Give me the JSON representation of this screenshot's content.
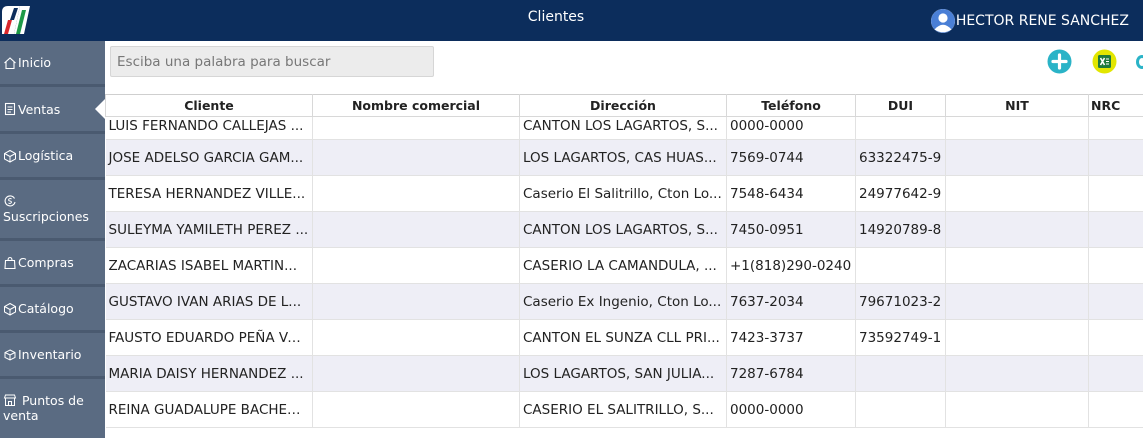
{
  "app": {
    "title": "Clientes",
    "user_name": "HECTOR RENE SANCHEZ"
  },
  "sidebar": {
    "items": [
      {
        "label": "Inicio",
        "icon": "home-icon"
      },
      {
        "label": "Ventas",
        "icon": "receipt-icon",
        "active": true
      },
      {
        "label": "Logística",
        "icon": "box-icon"
      },
      {
        "label": "Suscripciones",
        "icon": "dollar-cycle-icon"
      },
      {
        "label": "Compras",
        "icon": "shopping-bag-icon"
      },
      {
        "label": "Catálogo",
        "icon": "box-icon"
      },
      {
        "label": "Inventario",
        "icon": "boxes-icon"
      },
      {
        "label": "Puntos de venta",
        "icon": "store-icon"
      }
    ]
  },
  "search": {
    "placeholder": "Esciba una palabra para buscar",
    "value": ""
  },
  "toolbar": {
    "add_icon": "plus-circle-icon",
    "excel_icon": "excel-export-icon",
    "colors": {
      "add": "#2ab3c7",
      "excel_bg": "#e2e600",
      "excel_fg": "#1e7a3c"
    }
  },
  "table": {
    "headers": [
      "Cliente",
      "Nombre comercial",
      "Dirección",
      "Teléfono",
      "DUI",
      "NIT",
      "NRC"
    ],
    "rows": [
      [
        "LUIS FERNANDO CALLEJAS ...",
        "",
        "CANTON LOS LAGARTOS, S...",
        "0000-0000",
        "",
        "",
        ""
      ],
      [
        "JOSE ADELSO GARCIA GAM...",
        "",
        "LOS LAGARTOS, CAS HUAS...",
        "7569-0744",
        "63322475-9",
        "",
        ""
      ],
      [
        "TERESA HERNANDEZ VILLE...",
        "",
        "Caserio El Salitrillo, Cton Lo...",
        "7548-6434",
        "24977642-9",
        "",
        ""
      ],
      [
        "SULEYMA YAMILETH PEREZ ...",
        "",
        "CANTON LOS LAGARTOS, S...",
        "7450-0951",
        "14920789-8",
        "",
        ""
      ],
      [
        "ZACARIAS ISABEL MARTIN...",
        "",
        "CASERIO LA CAMANDULA, ...",
        "+1(818)290-0240",
        "",
        "",
        ""
      ],
      [
        "GUSTAVO IVAN ARIAS DE L...",
        "",
        "Caserio Ex Ingenio, Cton Lo...",
        "7637-2034",
        "79671023-2",
        "",
        ""
      ],
      [
        "FAUSTO EDUARDO PEÑA VA...",
        "",
        "CANTON EL SUNZA CLL PRI...",
        "7423-3737",
        "73592749-1",
        "",
        ""
      ],
      [
        "MARIA DAISY HERNANDEZ ...",
        "",
        "LOS LAGARTOS, SAN JULIA...",
        "7287-6784",
        "",
        "",
        ""
      ],
      [
        "REINA GUADALUPE BACHEZ...",
        "",
        "CASERIO EL SALITRILLO, S...",
        "0000-0000",
        "",
        "",
        ""
      ]
    ]
  }
}
